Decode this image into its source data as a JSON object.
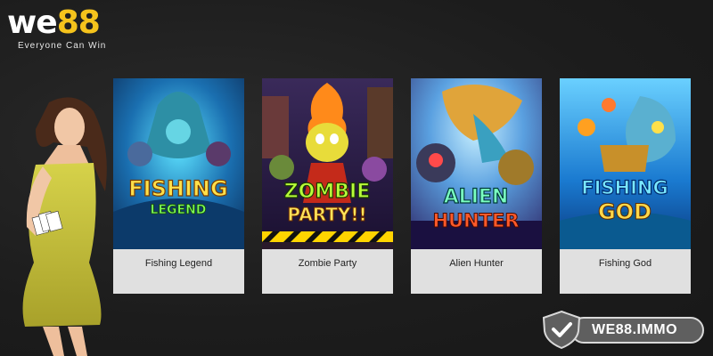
{
  "brand": {
    "logo_main": "we",
    "logo_accent": "88",
    "tagline": "Everyone Can Win"
  },
  "games": [
    {
      "title": "Fishing Legend",
      "art_line1": "FISHING",
      "art_line2": "LEGEND"
    },
    {
      "title": "Zombie Party",
      "art_line1": "ZOMBIE",
      "art_line2": "PARTY!!"
    },
    {
      "title": "Alien Hunter",
      "art_line1": "ALIEN",
      "art_line2": "HUNTER"
    },
    {
      "title": "Fishing God",
      "art_line1": "FISHING",
      "art_line2": "GOD"
    }
  ],
  "watermark": {
    "label": "WE88.IMMO",
    "icon": "shield-check-icon"
  },
  "colors": {
    "background": "#1f1f1f",
    "brand_accent": "#f5c31c",
    "card_caption": "#e0e0e0"
  }
}
